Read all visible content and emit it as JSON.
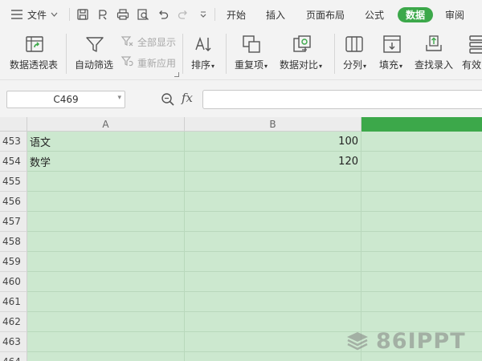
{
  "menubar": {
    "file_label": "文件",
    "tabs": [
      {
        "label": "开始",
        "active": false
      },
      {
        "label": "插入",
        "active": false
      },
      {
        "label": "页面布局",
        "active": false
      },
      {
        "label": "公式",
        "active": false
      },
      {
        "label": "数据",
        "active": true
      },
      {
        "label": "审阅",
        "active": false
      }
    ]
  },
  "ribbon": {
    "pivot_table": "数据透视表",
    "autofilter": "自动筛选",
    "show_all": "全部显示",
    "reapply": "重新应用",
    "sort": "排序",
    "duplicates": "重复项",
    "compare": "数据对比",
    "split": "分列",
    "fill": "填充",
    "lookup_entry": "查找录入",
    "validity": "有效"
  },
  "formula_bar": {
    "name_box": "C469",
    "fx_label": "fx",
    "formula": ""
  },
  "grid": {
    "columns": [
      "A",
      "B",
      ""
    ],
    "rows": [
      {
        "num": "453",
        "a": "语文",
        "b": "100"
      },
      {
        "num": "454",
        "a": "数学",
        "b": "120"
      },
      {
        "num": "455",
        "a": "",
        "b": ""
      },
      {
        "num": "456",
        "a": "",
        "b": ""
      },
      {
        "num": "457",
        "a": "",
        "b": ""
      },
      {
        "num": "458",
        "a": "",
        "b": ""
      },
      {
        "num": "459",
        "a": "",
        "b": ""
      },
      {
        "num": "460",
        "a": "",
        "b": ""
      },
      {
        "num": "461",
        "a": "",
        "b": ""
      },
      {
        "num": "462",
        "a": "",
        "b": ""
      },
      {
        "num": "463",
        "a": "",
        "b": ""
      },
      {
        "num": "464",
        "a": "",
        "b": ""
      }
    ]
  },
  "watermark": "86IPPT",
  "colors": {
    "accent": "#3ca84a",
    "grid_fill": "#cce8cf",
    "toolbar_bg": "#f3f3f3"
  }
}
